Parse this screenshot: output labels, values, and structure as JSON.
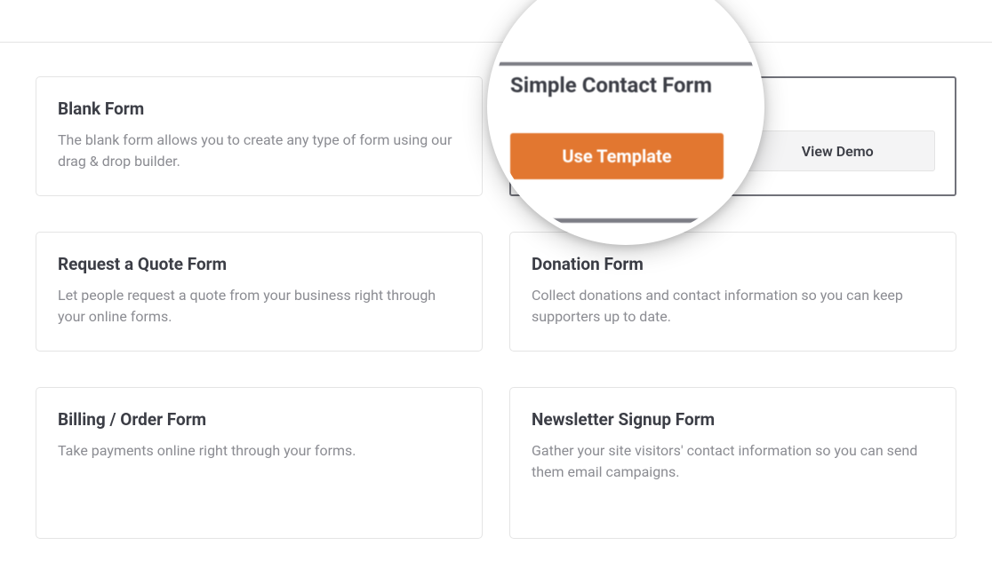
{
  "templates": [
    {
      "title": "Blank Form",
      "desc": "The blank form allows you to create any type of form using our drag & drop builder."
    },
    {
      "title": "Simple Contact Form",
      "desc": "",
      "use_label": "Use Template",
      "demo_label": "View Demo"
    },
    {
      "title": "Request a Quote Form",
      "desc": "Let people request a quote from your business right through your online forms."
    },
    {
      "title": "Donation Form",
      "desc": "Collect donations and contact information so you can keep supporters up to date."
    },
    {
      "title": "Billing / Order Form",
      "desc": "Take payments online right through your forms."
    },
    {
      "title": "Newsletter Signup Form",
      "desc": "Gather your site visitors' contact information so you can send them email campaigns."
    }
  ],
  "magnifier": {
    "title": "Simple Contact Form",
    "use_label": "Use Template"
  }
}
